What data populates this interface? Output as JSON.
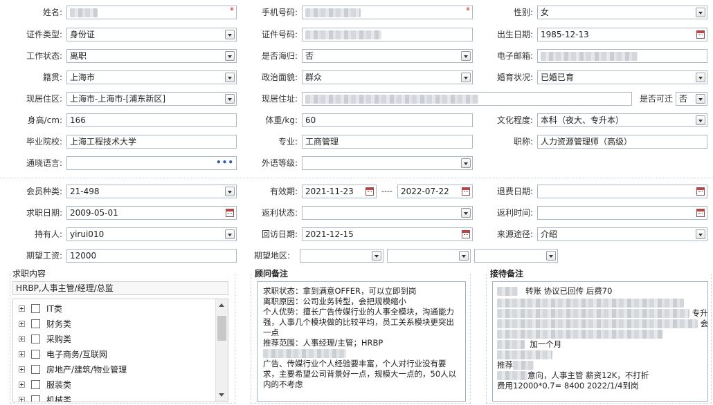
{
  "basic": {
    "name_label": "姓名:",
    "phone_label": "手机号码:",
    "gender_label": "性别:",
    "gender_value": "女",
    "id_type_label": "证件类型:",
    "id_type_value": "身份证",
    "id_no_label": "证件号码:",
    "birth_label": "出生日期:",
    "birth_value": "1985-12-13",
    "work_status_label": "工作状态:",
    "work_status_value": "离职",
    "overseas_label": "是否海归:",
    "overseas_value": "否",
    "email_label": "电子邮箱:",
    "native_label": "籍贯:",
    "native_value": "上海市",
    "political_label": "政治面貌:",
    "political_value": "群众",
    "marital_label": "婚育状况:",
    "marital_value": "已婚已育",
    "area_label": "现居住区:",
    "area_value": "上海市-上海市-[浦东新区]",
    "address_label": "现居住址:",
    "relocate_label": "是否可迁",
    "relocate_value": "否",
    "height_label": "身高/cm:",
    "height_value": "166",
    "weight_label": "体重/kg:",
    "weight_value": "60",
    "education_label": "文化程度:",
    "education_value": "本科（夜大、专升本）",
    "school_label": "毕业院校:",
    "school_value": "上海工程技术大学",
    "major_label": "专业:",
    "major_value": "工商管理",
    "title_label": "职称:",
    "title_value": "人力资源管理师（高级）",
    "language_label": "通晓语言:",
    "language_more": "•••",
    "foreign_label": "外语等级:",
    "required_mark": "*"
  },
  "member": {
    "type_label": "会员种类:",
    "type_value": "21-498",
    "valid_label": "有效期:",
    "valid_from": "2021-11-23",
    "valid_sep": "----",
    "valid_to": "2022-07-22",
    "refund_date_label": "退费日期:",
    "job_date_label": "求职日期:",
    "job_date_value": "2009-05-01",
    "rebate_status_label": "返利状态:",
    "rebate_time_label": "返利时间:",
    "holder_label": "持有人:",
    "holder_value": "yirui010",
    "visit_date_label": "回访日期:",
    "visit_date_value": "2021-12-15",
    "source_label": "来源途径:",
    "source_value": "介绍",
    "salary_label": "期望工资:",
    "salary_value": "12000",
    "region_label": "期望地区:"
  },
  "job_content": {
    "title": "求职内容",
    "summary": "HRBP,人事主管/经理/总监",
    "tree": [
      "IT类",
      "财务类",
      "采购类",
      "电子商务/互联网",
      "房地产/建筑/物业管理",
      "服装类",
      "机械类"
    ]
  },
  "advisor_notes": {
    "title": "顾问备注",
    "lines": [
      "求职状态：拿到满意OFFER，可以立即到岗",
      "离职原因：公司业务转型，会把规模缩小",
      "个人优势：擅长广告传媒行业的人事全模块，沟通能力",
      "强，人事几个模块做的比较平均，员工关系模块更突出",
      "一点",
      "推荐范围：人事经理/主管；HRBP",
      "",
      "广告、传媒行业个人经验要丰富，个人对行业没有要",
      "求，主要希望公司背景好一点，规模大一点的，50人以",
      "内的不考虑"
    ]
  },
  "reception_notes": {
    "title": "接待备注",
    "line1": "转账   协议已回传   后费70",
    "trail_a": "专升",
    "trail_b": "会",
    "line_month": "加一个月",
    "line_rec": "推荐",
    "line_intent": "意向，人事主管   薪资12K，不打折",
    "line_fee": "费用12000*0.7= 8400   2022/1/4到岗"
  }
}
